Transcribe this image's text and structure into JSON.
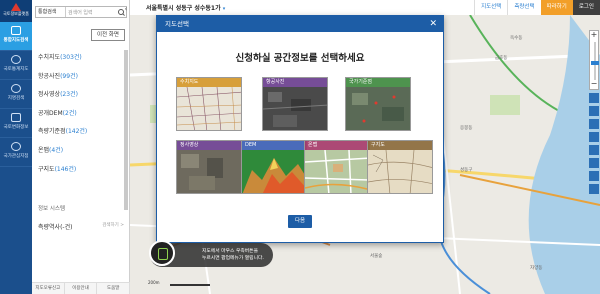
{
  "rail": {
    "logo_label": "국토정보플랫폼",
    "items": [
      {
        "label": "통합지도검색",
        "icon": "map-icon",
        "active": true
      },
      {
        "label": "국토통계지도",
        "icon": "pie-chart-icon",
        "active": false
      },
      {
        "label": "지명검색",
        "icon": "pin-icon",
        "active": false
      },
      {
        "label": "국토변화정보",
        "icon": "change-icon",
        "active": false
      },
      {
        "label": "국가관심지점",
        "icon": "target-icon",
        "active": false
      }
    ]
  },
  "search": {
    "scope": "통합검색",
    "placeholder": "검색어 입력",
    "prev_button": "이전 화면"
  },
  "categories": [
    {
      "name": "수치지도",
      "count": "(303건)"
    },
    {
      "name": "항공사진",
      "count": "(99건)"
    },
    {
      "name": "정사영상",
      "count": "(23건)"
    },
    {
      "name": "공개DEM",
      "count": "(2건)"
    },
    {
      "name": "측량기준점",
      "count": "(142건)"
    },
    {
      "name": "온맵",
      "count": "(4건)"
    },
    {
      "name": "구지도",
      "count": "(146건)"
    }
  ],
  "info_section": {
    "title": "정보 시스템",
    "history": "측량역사(-건)",
    "more": "검색하기 >"
  },
  "panel_footer": [
    "지도오류신고",
    "이용안내",
    "도움말"
  ],
  "topbar": {
    "location": "서울특별시 성동구 성수동1가",
    "buttons": [
      "지도선택",
      "측량선택",
      "따라하기",
      "로그인"
    ]
  },
  "map_labels": [
    "성동구",
    "금호동",
    "응봉동",
    "옥수동",
    "서울숲",
    "자양동"
  ],
  "modal": {
    "title": "지도선택",
    "heading": "신청하실 공간정보를 선택하세요",
    "tiles": [
      {
        "label": "수치지도",
        "color": "#d4972a"
      },
      {
        "label": "항공사진",
        "color": "#6b3e8f"
      },
      {
        "label": "국가기준점",
        "color": "#3f8a3f"
      },
      {
        "label": "정사영상",
        "color": "#6b3e8f"
      },
      {
        "label": "DEM",
        "color": "#3b5fb5"
      },
      {
        "label": "온맵",
        "color": "#a63a6a"
      },
      {
        "label": "구지도",
        "color": "#8a6a3a"
      }
    ],
    "confirm": "다음"
  },
  "tooltip": {
    "line1": "지도에서 마우스 우측버튼을",
    "line2": "누르시면 팝업메뉴가 열립니다."
  },
  "scale": "200m"
}
